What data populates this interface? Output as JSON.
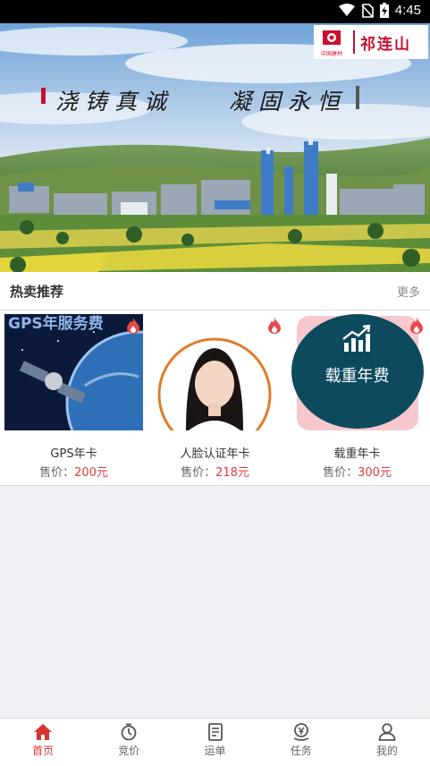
{
  "status_bar": {
    "time": "4:45"
  },
  "banner": {
    "brand_logo_text": "中国建材",
    "brand_name": "祁连山",
    "slogan_left": "浇铸真诚",
    "slogan_right": "凝固永恒"
  },
  "hot": {
    "title": "热卖推荐",
    "more": "更多",
    "products": [
      {
        "name": "GPS年卡",
        "price_label": "售价：",
        "price": "200元",
        "image_text": "GPS年服务费",
        "icon": "satellite-image"
      },
      {
        "name": "人脸认证年卡",
        "price_label": "售价：",
        "price": "218元",
        "icon": "face-photo"
      },
      {
        "name": "载重年卡",
        "price_label": "售价：",
        "price": "300元",
        "image_text": "载重年费",
        "icon": "chart-up-icon"
      }
    ]
  },
  "nav": {
    "items": [
      {
        "label": "首页",
        "icon": "home-icon",
        "active": true
      },
      {
        "label": "竞价",
        "icon": "stopwatch-icon"
      },
      {
        "label": "运单",
        "icon": "document-icon"
      },
      {
        "label": "任务",
        "icon": "task-icon"
      },
      {
        "label": "我的",
        "icon": "user-icon"
      }
    ]
  },
  "colors": {
    "accent": "#d9332f",
    "price": "#e03c3c",
    "brand": "#c8102e",
    "badge_teal": "#0d4a5e"
  }
}
